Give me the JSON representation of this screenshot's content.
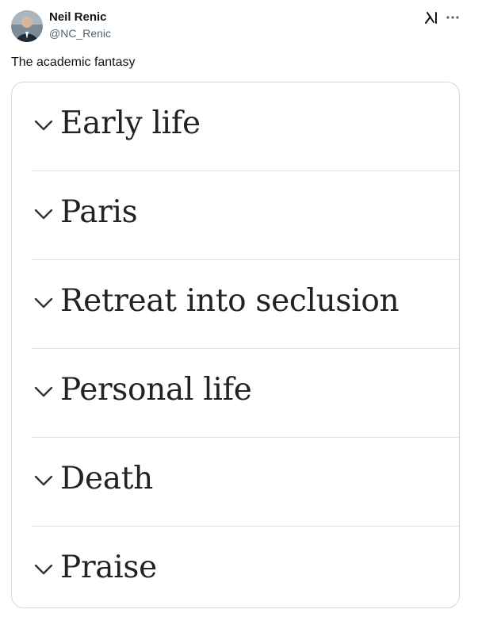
{
  "tweet": {
    "author": {
      "name": "Neil Renic",
      "handle": "@NC_Renic",
      "avatar_icon": "avatar-photo"
    },
    "text": "The academic fantasy",
    "icons": {
      "brand": "grok-icon",
      "menu": "more-icon"
    }
  },
  "image": {
    "sections": [
      {
        "label": "Early life",
        "icon": "chevron-down-icon"
      },
      {
        "label": "Paris",
        "icon": "chevron-down-icon"
      },
      {
        "label": "Retreat into seclusion",
        "icon": "chevron-down-icon"
      },
      {
        "label": "Personal life",
        "icon": "chevron-down-icon"
      },
      {
        "label": "Death",
        "icon": "chevron-down-icon"
      },
      {
        "label": "Praise",
        "icon": "chevron-down-icon"
      }
    ]
  },
  "colors": {
    "text_primary": "#0f1419",
    "text_secondary": "#536471",
    "card_border": "#cfd9de",
    "section_text": "#222222",
    "divider": "#e3e3e3"
  }
}
